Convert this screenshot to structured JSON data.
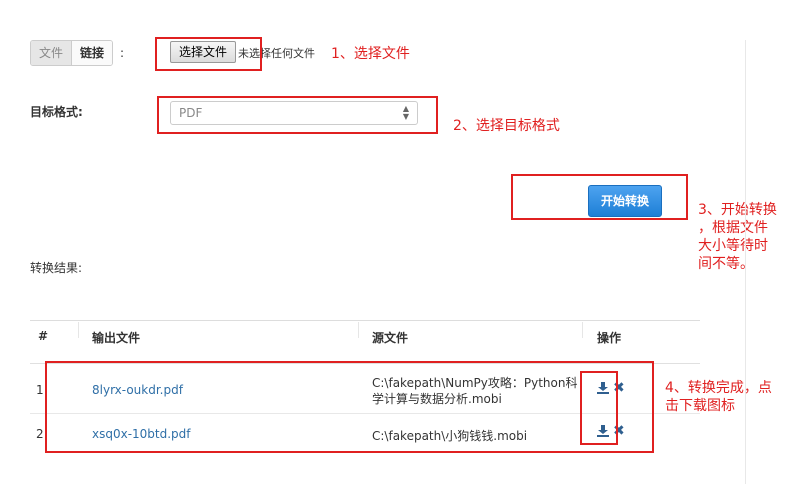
{
  "source": {
    "tabs": [
      "文件",
      "链接"
    ],
    "colon": ":",
    "choose_button": "选择文件",
    "no_file_text": "未选择任何文件"
  },
  "format": {
    "label": "目标格式:",
    "selected": "PDF"
  },
  "start_button": "开始转换",
  "results": {
    "label": "转换结果:",
    "columns": [
      "#",
      "输出文件",
      "源文件",
      "操作"
    ],
    "rows": [
      {
        "index": "1",
        "output": "8lyrx-oukdr.pdf",
        "source_line1": "C:\\fakepath\\NumPy攻略：Python科",
        "source_line2": "学计算与数据分析.mobi"
      },
      {
        "index": "2",
        "output": "xsq0x-10btd.pdf",
        "source_line1": "C:\\fakepath\\小狗钱钱.mobi",
        "source_line2": ""
      }
    ]
  },
  "annotations": {
    "step1": "1、选择文件",
    "step2": "2、选择目标格式",
    "step3_lines": [
      "3、开始转换",
      "，根据文件",
      "大小等待时",
      "间不等。"
    ],
    "step4_lines": [
      "4、转换完成，点",
      "击下载图标"
    ]
  },
  "colors": {
    "annotation_red": "#e02020",
    "link_blue": "#2f6fa7",
    "primary_blue": "#1e7fd6"
  }
}
